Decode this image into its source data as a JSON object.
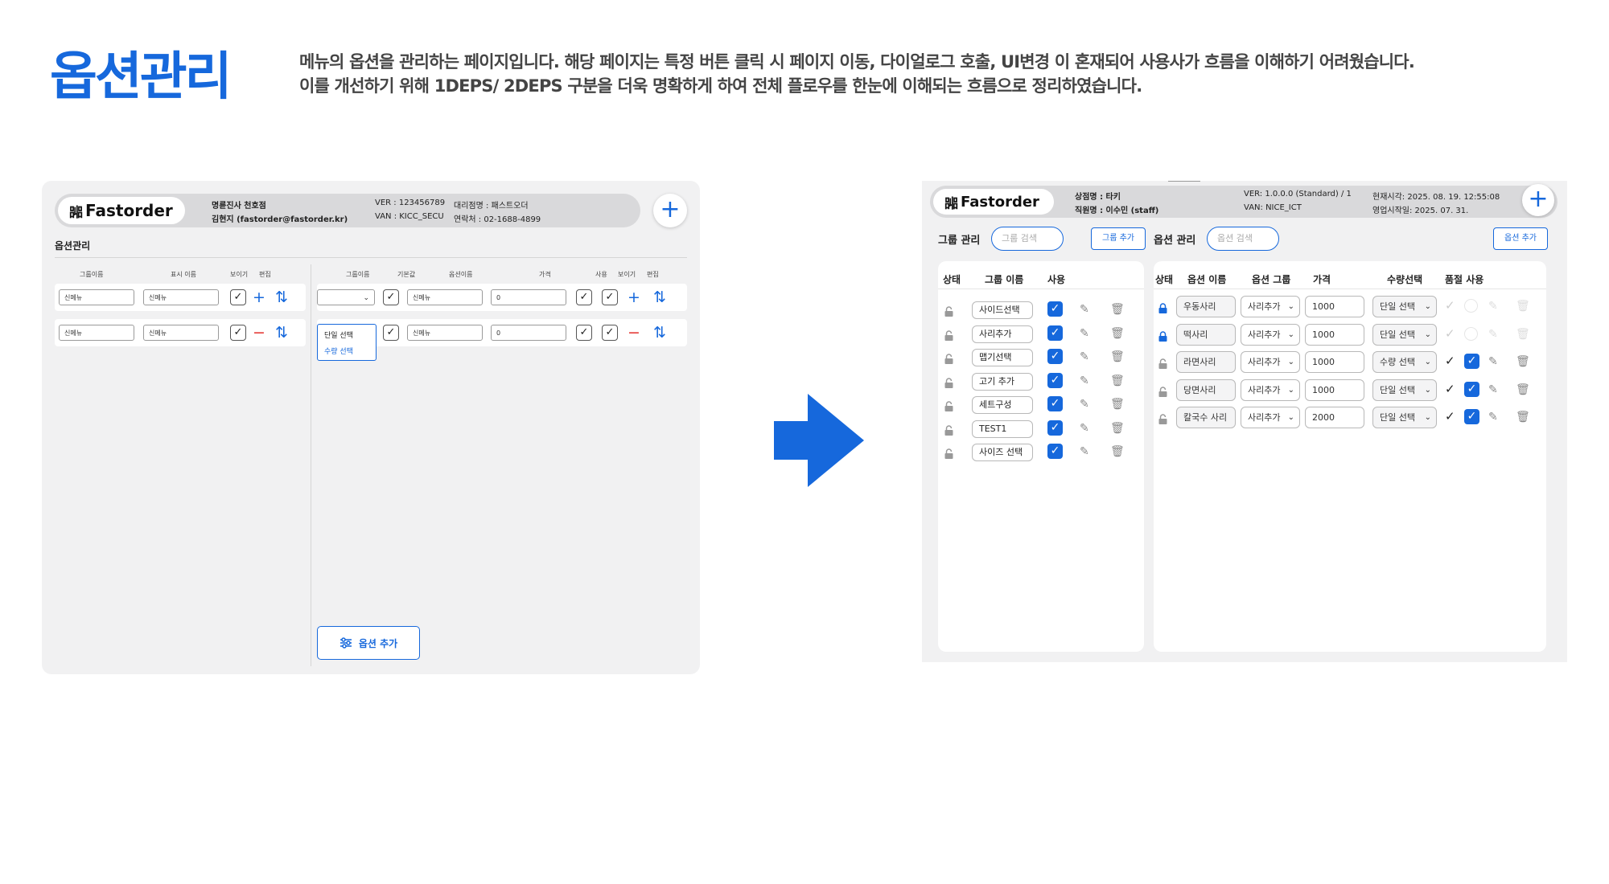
{
  "page": {
    "title": "옵션관리",
    "desc_line1": "메뉴의 옵션을 관리하는 페이지입니다. 해당 페이지는 특정 버튼 클릭 시 페이지 이동, 다이얼로그 호출, UI변경 이 혼재되어 사용사가 흐름을 이해하기 어려웠습니다.",
    "desc_line2": "이를 개선하기 위해 1DEPS/ 2DEPS 구분을 더욱 명확하게 하여 전체 플로우를 한눈에 이해되는 흐름으로 정리하였습니다."
  },
  "colors": {
    "accent": "#1668dc",
    "danger": "#e53935",
    "panel_bg": "#f1f1f2"
  },
  "old": {
    "logo_mark": "嘂",
    "logo_text": "Fastorder",
    "store": "명륜진사 천호점",
    "user": "김현지 (fastorder@fastorder.kr)",
    "ver": "VER : 123456789",
    "van": "VAN : KICC_SECU",
    "agency": "대리점명 : 패스트오더",
    "contact": "연락처 : 02-1688-4899",
    "section_title": "옵션관리",
    "left_headers": [
      "그룹이름",
      "표시 이름",
      "보이기",
      "편집"
    ],
    "right_headers": [
      "그룹이름",
      "기본값",
      "옵션이름",
      "가격",
      "사용",
      "보이기",
      "편집"
    ],
    "rows": [
      {
        "group": "신메뉴",
        "display": "신메뉴",
        "action": "+"
      },
      {
        "group": "신메뉴",
        "display": "신메뉴",
        "action": "−"
      }
    ],
    "opt_rows": [
      {
        "option": "신메뉴",
        "price": "0",
        "action": "+"
      },
      {
        "option": "신메뉴",
        "price": "0",
        "action": "−"
      }
    ],
    "dropdown_items": [
      "단일 선택",
      "수량 선택"
    ],
    "add_option_label": "옵션 추가",
    "sort_icon": "⇅"
  },
  "new": {
    "logo_text": "Fastorder",
    "store": "상점명 : 타키",
    "staff": "직원명 : 이수민 (staff)",
    "ver": "VER: 1.0.0.0  (Standard) / 1",
    "van": "VAN: NICE_ICT",
    "now": "현재시각: 2025. 08. 19. 12:55:08",
    "open": "영업시작일: 2025. 07. 31.",
    "group_mgmt": "그룹 관리",
    "group_search": "그룹 검색",
    "group_add": "그룹 추가",
    "option_mgmt": "옵션 관리",
    "option_search": "옵션 검색",
    "option_add": "옵션 추가",
    "group_headers": [
      "상태",
      "그룹 이름",
      "사용"
    ],
    "groups": [
      "사이드선택",
      "사리추가",
      "맵기선택",
      "고기 추가",
      "세트구성",
      "TEST1",
      "사이즈 선택"
    ],
    "option_headers": [
      "상태",
      "옵션 이름",
      "옵션 그룹",
      "가격",
      "수량선택",
      "품절 사용"
    ],
    "options": [
      {
        "name": "우동사리",
        "group": "사리추가",
        "price": "1000",
        "mode": "단일 선택",
        "locked": true
      },
      {
        "name": "떡사리",
        "group": "사리추가",
        "price": "1000",
        "mode": "단일 선택",
        "locked": true
      },
      {
        "name": "라면사리",
        "group": "사리추가",
        "price": "1000",
        "mode": "수량 선택",
        "locked": false
      },
      {
        "name": "당면사리",
        "group": "사리추가",
        "price": "1000",
        "mode": "단일 선택",
        "locked": false
      },
      {
        "name": "칼국수 사리",
        "group": "사리추가",
        "price": "2000",
        "mode": "단일 선택",
        "locked": false
      }
    ]
  }
}
